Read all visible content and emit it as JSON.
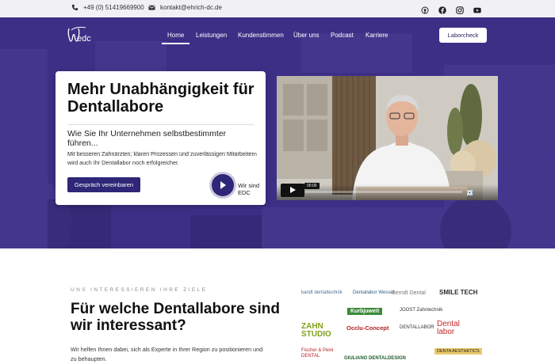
{
  "topbar": {
    "phone": "+49 (0) 51419669900",
    "email": "kontakt@ehrich-dc.de",
    "social_icons": [
      "podcast-icon",
      "facebook-icon",
      "instagram-icon",
      "youtube-icon"
    ]
  },
  "header": {
    "logo_text": "edc",
    "nav": [
      "Home",
      "Leistungen",
      "Kundenstimmen",
      "Über uns",
      "Podcast",
      "Karriere"
    ],
    "cta_label": "Laborcheck"
  },
  "hero": {
    "title": "Mehr Unabhängigkeit für Dentallabore",
    "subtitle": "Wie Sie Ihr Unternehmen selbstbestimmter führen...",
    "description": "Mit besseren Zahnärzten, klaren Prozessen und zuverlässigen Mitarbeitern wird auch Ihr Dentallabor noch erfolgreicher.",
    "button_label": "Gespräch vereinbaren",
    "play_label": "Wir sind EDC",
    "video_time": "00:00"
  },
  "section": {
    "eyebrow": "UNS INTERESSIEREN IHRE ZIELE",
    "title": "Für welche Dentallabore sind wir interessant?",
    "body": "Wir helfen Ihnen dabei, sich als Experte in Ihrer Region zu positionieren und zu behaupten."
  },
  "logos": [
    "kandt dentaltechnik",
    "Dentallabor Wessel",
    "Berndt Dental",
    "SMILE TECH",
    "Kurbjuweit",
    "JOOST Zahntechnik",
    "ZAHN STUDIO",
    "Occlu-Concept",
    "DENTALLABOR",
    "Dental labor",
    "Fischer & Peini DENTAL",
    "GIULIANO DENTALDESIGN",
    "DENTA AESTHETICS"
  ],
  "colors": {
    "brand": "#3d2f86",
    "button": "#2e2677"
  }
}
